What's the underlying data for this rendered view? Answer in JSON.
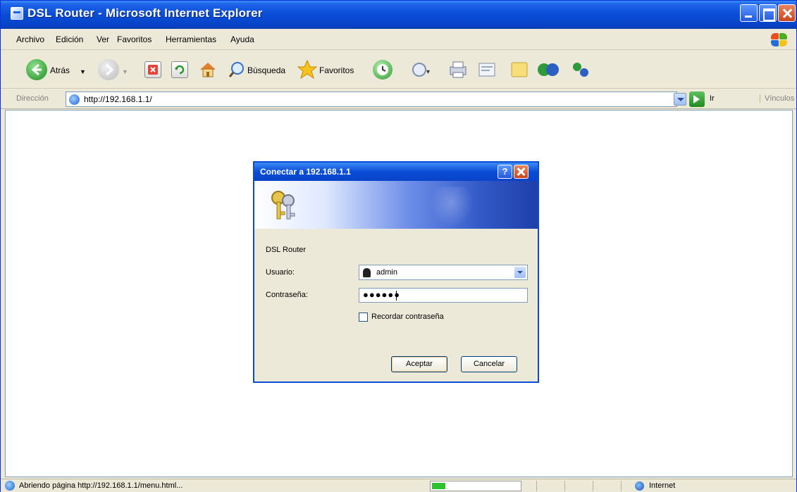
{
  "window": {
    "title": "DSL Router - Microsoft Internet Explorer"
  },
  "menubar": {
    "items": [
      "Archivo",
      "Edición",
      "Ver",
      "Favoritos",
      "Herramientas",
      "Ayuda"
    ]
  },
  "toolbar": {
    "back_label": "Atrás",
    "search_label": "Búsqueda",
    "favorites_label": "Favoritos"
  },
  "address": {
    "label": "Dirección",
    "url": "http://192.168.1.1/",
    "go_label": "Ir",
    "links_label": "Vínculos"
  },
  "dialog": {
    "title": "Conectar a 192.168.1.1",
    "site": "DSL Router",
    "user_label": "Usuario:",
    "user_value": "admin",
    "password_label": "Contraseña:",
    "password_value": "●●●●●●",
    "remember_label": "Recordar contraseña",
    "remember_checked": false,
    "ok_label": "Aceptar",
    "cancel_label": "Cancelar",
    "help_label": "?"
  },
  "statusbar": {
    "text": "Abriendo página http://192.168.1.1/menu.html...",
    "progress_fraction": 0.15,
    "zone": "Internet"
  },
  "colors": {
    "xp_blue": "#0A4CD6",
    "chrome": "#ECE9D8",
    "close_red": "#C94620",
    "progress_green": "#2EC22E"
  }
}
